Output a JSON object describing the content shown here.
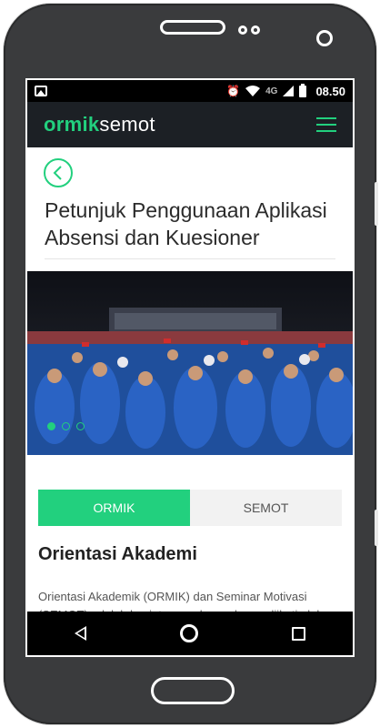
{
  "status_bar": {
    "time": "08.50",
    "network": "4G",
    "icons": [
      "gallery-icon",
      "alarm-icon",
      "wifi-icon",
      "signal-icon",
      "battery-icon"
    ]
  },
  "header": {
    "brand_part1": "ormik",
    "brand_part2": "semot",
    "menu_icon": "hamburger-icon"
  },
  "page": {
    "title": "Petunjuk Penggunaan Aplikasi Absensi dan Kuesioner",
    "back_icon": "chevron-left-icon"
  },
  "carousel": {
    "slide_count": 3,
    "active_index": 0
  },
  "tabs": [
    {
      "label": "ORMIK",
      "active": true
    },
    {
      "label": "SEMOT",
      "active": false
    }
  ],
  "section": {
    "title": "Orientasi Akademi",
    "body": "Orientasi Akademik (ORMIK) dan Seminar Motivasi (SEMOT) adalah kegiatan awal yang harus diikuti oleh"
  },
  "colors": {
    "accent": "#22d07e",
    "header_bg": "#1c2025",
    "phone_body": "#3a3b3d"
  },
  "nav_bar": {
    "icons": [
      "back-nav-icon",
      "home-nav-icon",
      "recent-apps-icon"
    ]
  }
}
